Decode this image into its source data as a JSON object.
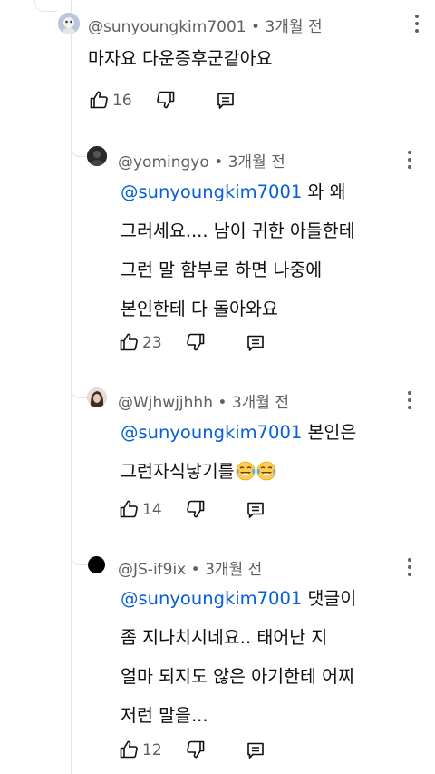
{
  "comments": [
    {
      "handle": "@sunyoungkim7001",
      "time": "• 3개월 전",
      "text": "마자요 다운증후군같아요",
      "likes": "16"
    },
    {
      "handle": "@yomingyo",
      "time": "• 3개월 전",
      "mention": "@sunyoungkim7001",
      "line1_rest": " 와 왜",
      "line2": "그러세요.... 남이 귀한 아들한테",
      "line3": "그런 말 함부로 하면 나중에",
      "line4": "본인한테 다 돌아와요",
      "likes": "23"
    },
    {
      "handle": "@Wjhwjjhhh",
      "time": "• 3개월 전",
      "mention": "@sunyoungkim7001",
      "line1_rest": " 본인은",
      "line2": "그런자식낳기를",
      "likes": "14"
    },
    {
      "handle": "@JS-if9ix",
      "time": "• 3개월 전",
      "mention": "@sunyoungkim7001",
      "line1_rest": "  댓글이",
      "line2": "좀 지나치시네요.. 태어난 지",
      "line3": "얼마 되지도 않은 아기한테 어찌",
      "line4": "저런 말을...",
      "likes": "12"
    }
  ],
  "icons": {
    "like": "thumbs-up-icon",
    "dislike": "thumbs-down-icon",
    "reply": "reply-icon",
    "more": "more-vert-icon",
    "emoji": "face-with-tears-of-joy-emoji"
  },
  "colors": {
    "mention": "#065fd4",
    "meta": "#606060",
    "text": "#0f0f0f"
  }
}
